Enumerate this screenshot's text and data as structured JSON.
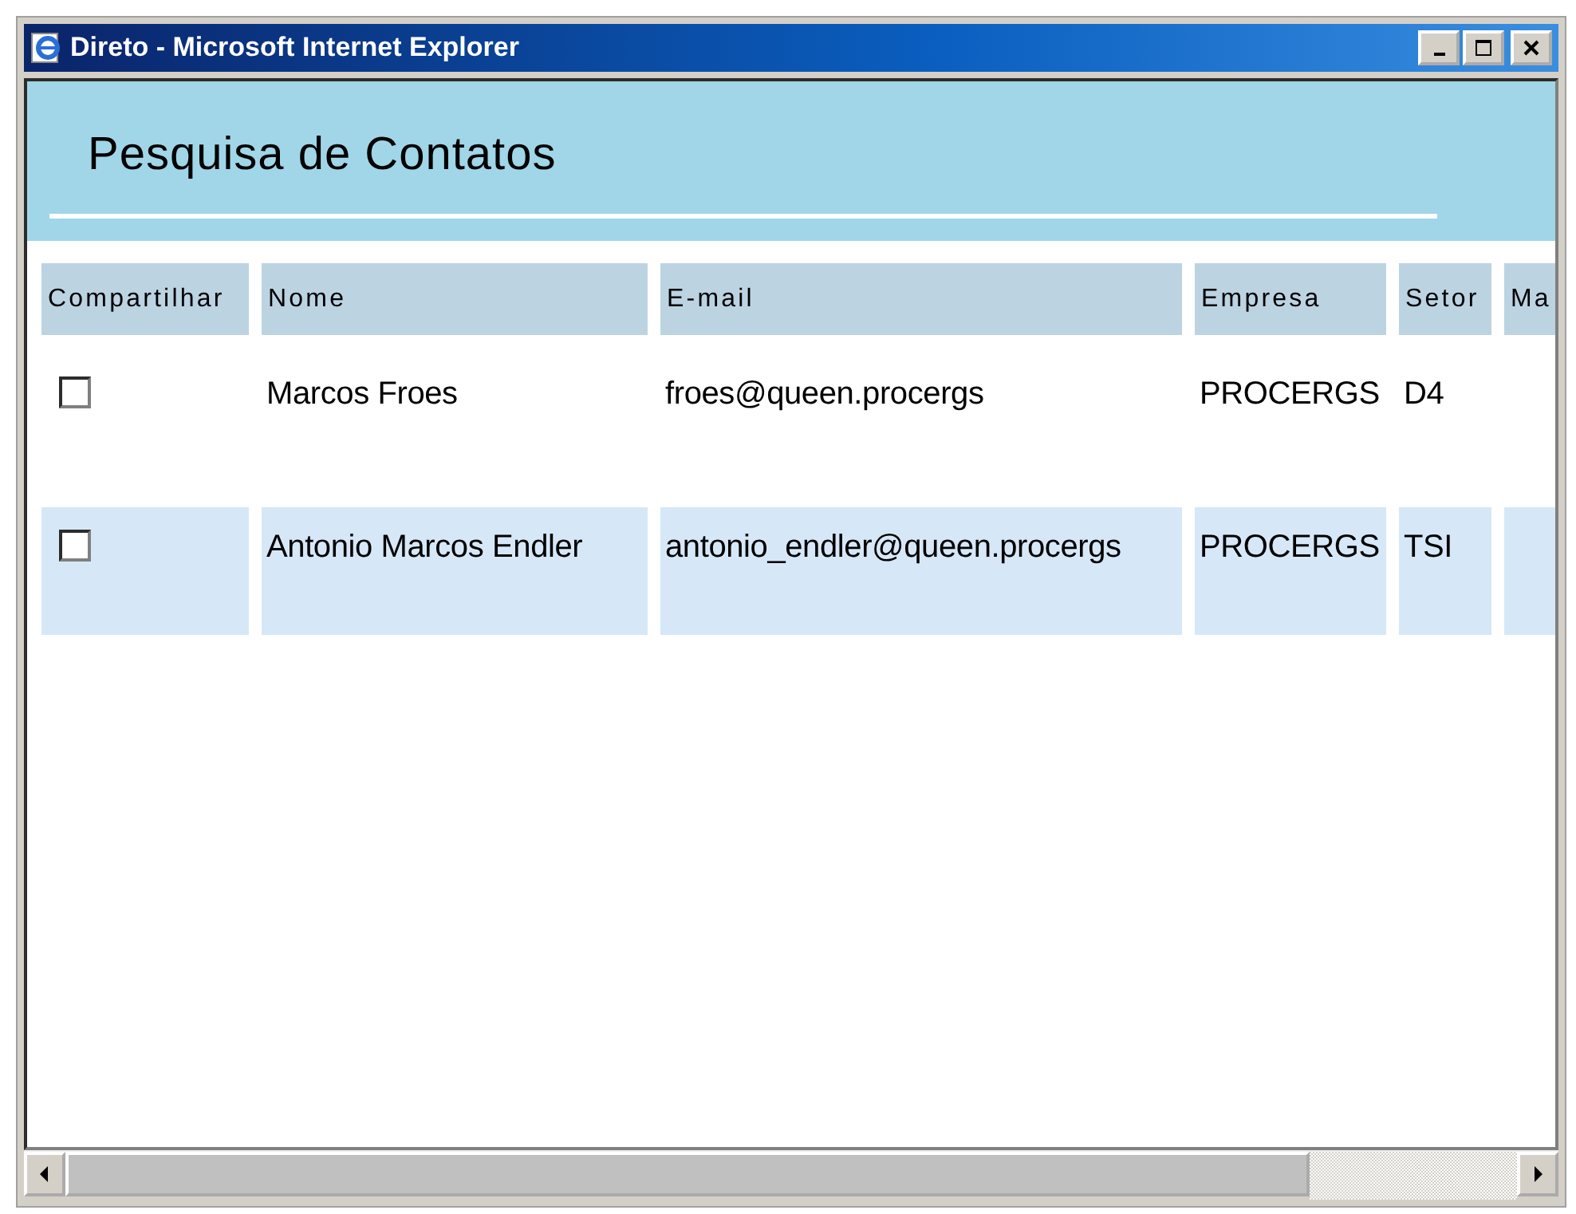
{
  "window": {
    "title": "Direto - Microsoft Internet Explorer"
  },
  "page": {
    "heading": "Pesquisa de Contatos"
  },
  "table": {
    "columns": [
      "Compartilhar",
      "Nome",
      "E-mail",
      "Empresa",
      "Setor",
      "Ma"
    ],
    "rows": [
      {
        "cells": [
          {
            "kind": "checkbox",
            "checked": false
          },
          {
            "kind": "text",
            "text": "Marcos Froes"
          },
          {
            "kind": "text",
            "text": "froes@queen.procergs"
          },
          {
            "kind": "text",
            "text": "PROCERGS"
          },
          {
            "kind": "text",
            "text": "D4"
          }
        ]
      },
      {
        "cells": [
          {
            "kind": "checkbox",
            "checked": false
          },
          {
            "kind": "text",
            "text": "Antonio Marcos Endler"
          },
          {
            "kind": "text",
            "text": "antonio_endler@queen.procergs"
          },
          {
            "kind": "text",
            "text": "PROCERGS"
          },
          {
            "kind": "text",
            "text": "TSI"
          }
        ]
      }
    ]
  }
}
